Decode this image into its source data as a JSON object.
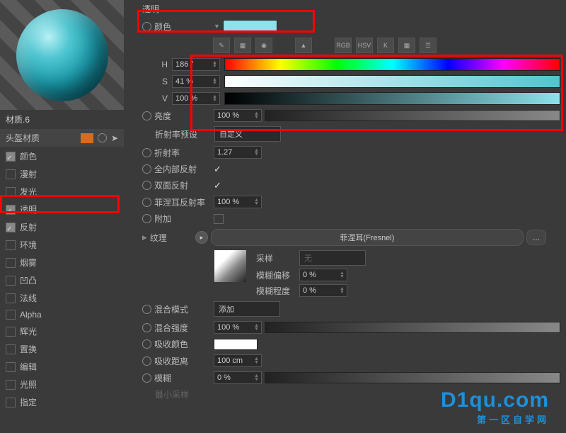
{
  "material_name": "材质.6",
  "layer_name": "头盔材质",
  "channels": [
    {
      "label": "颜色",
      "on": true
    },
    {
      "label": "漫射",
      "on": false
    },
    {
      "label": "发光",
      "on": false
    },
    {
      "label": "透明",
      "on": true
    },
    {
      "label": "反射",
      "on": true
    },
    {
      "label": "环境",
      "on": false
    },
    {
      "label": "烟雾",
      "on": false
    },
    {
      "label": "凹凸",
      "on": false
    },
    {
      "label": "法线",
      "on": false
    },
    {
      "label": "Alpha",
      "on": false
    },
    {
      "label": "辉光",
      "on": false
    },
    {
      "label": "置换",
      "on": false
    },
    {
      "label": "编辑",
      "on": false
    },
    {
      "label": "光照",
      "on": false
    },
    {
      "label": "指定",
      "on": false
    }
  ],
  "panel_title": "透明",
  "props": {
    "color_label": "颜色",
    "h_label": "H",
    "h_val": "186 °",
    "s_label": "S",
    "s_val": "41 %",
    "v_label": "V",
    "v_val": "100 %",
    "brightness_label": "亮度",
    "brightness_val": "100 %",
    "refract_preset_label": "折射率预设",
    "refract_preset_val": "自定义",
    "refract_label": "折射率",
    "refract_val": "1.27",
    "tir_label": "全内部反射",
    "dbl_label": "双面反射",
    "fresnel_label": "菲涅耳反射率",
    "fresnel_val": "100 %",
    "add_label": "附加",
    "tex_label": "纹理",
    "tex_val": "菲涅耳(Fresnel)",
    "sample_label": "采样",
    "sample_val": "无",
    "blur_offset_label": "模糊偏移",
    "blur_offset_val": "0 %",
    "blur_scale_label": "模糊程度",
    "blur_scale_val": "0 %",
    "blend_mode_label": "混合模式",
    "blend_mode_val": "添加",
    "blend_str_label": "混合强度",
    "blend_str_val": "100 %",
    "absorb_color_label": "吸收颜色",
    "absorb_dist_label": "吸收距离",
    "absorb_dist_val": "100 cm",
    "blur_label": "模糊",
    "blur_val": "0 %",
    "min_sample_label": "最小采样"
  },
  "toolbar": {
    "rgb": "RGB",
    "hsv": "HSV",
    "k": "K"
  },
  "watermark": {
    "main": "D1qu.com",
    "sub": "第一区自学网"
  }
}
